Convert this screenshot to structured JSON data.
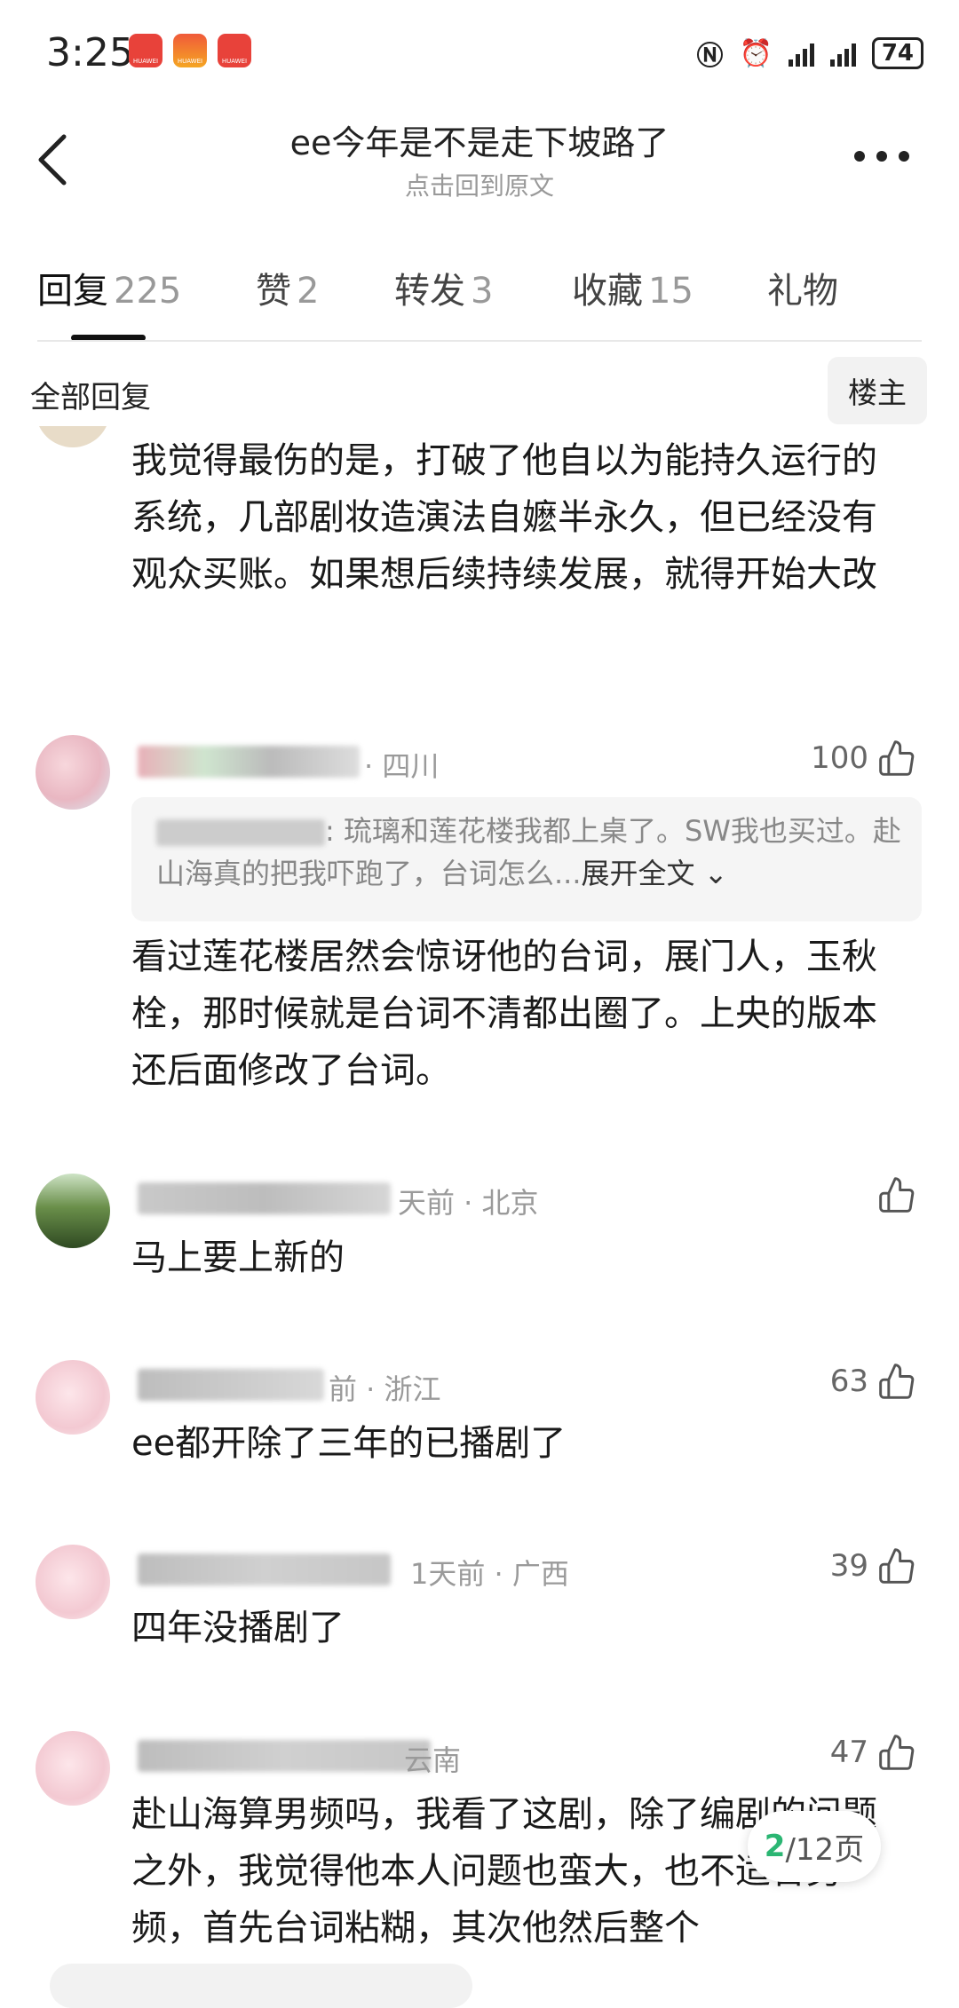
{
  "status_bar": {
    "time": "3:25",
    "battery": "74",
    "badge_label": "HUAWEI"
  },
  "header": {
    "title": "ee今年是不是走下坡路了",
    "subtitle": "点击回到原文"
  },
  "tabs": [
    {
      "label": "回复",
      "count": "225"
    },
    {
      "label": "赞",
      "count": "2"
    },
    {
      "label": "转发",
      "count": "3"
    },
    {
      "label": "收藏",
      "count": "15"
    },
    {
      "label": "礼物",
      "count": ""
    }
  ],
  "filter": {
    "label": "全部回复",
    "op_button": "楼主"
  },
  "comments": [
    {
      "text": "我觉得最伤的是，打破了他自以为能持久运行的系统，几部剧妆造演法自嬷半永久，但已经没有观众买账。如果想后续持续发展，就得开始大改"
    },
    {
      "meta": "· 四川",
      "likes": "100",
      "quote": {
        "text": ": 琉璃和莲花楼我都上桌了。SW我也买过。赴山海真的把我吓跑了，台词怎么...",
        "expand": "展开全文"
      },
      "text": "看过莲花楼居然会惊讶他的台词，展门人，玉秋栓，那时候就是台词不清都出圈了。上央的版本还后面修改了台词。"
    },
    {
      "meta": "天前 · 北京",
      "likes": "",
      "text": "马上要上新的"
    },
    {
      "meta": "前 · 浙江",
      "likes": "63",
      "text": "ee都开除了三年的已播剧了"
    },
    {
      "meta": "1天前 · 广西",
      "likes": "39",
      "text": "四年没播剧了"
    },
    {
      "meta": "云南",
      "likes": "47",
      "text": "赴山海算男频吗，我看了这剧，除了编剧的问题之外，我觉得他本人问题也蛮大，也不适合男频，首先台词粘糊，其次他然后整个"
    }
  ],
  "pagination": {
    "current": "2",
    "total": "/12页"
  },
  "colors": {
    "accent": "#2bb673",
    "badge": "#e8423a"
  }
}
